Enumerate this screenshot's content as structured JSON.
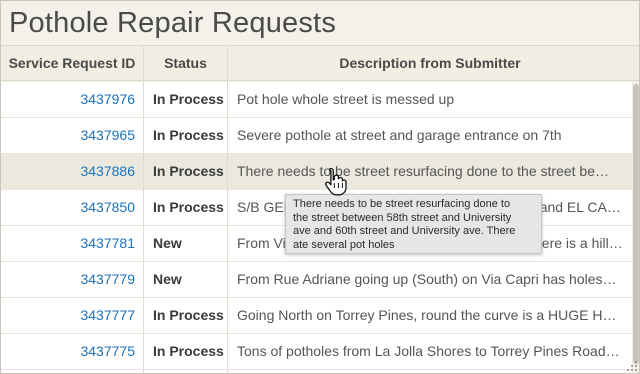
{
  "page": {
    "title": "Pothole Repair Requests"
  },
  "table": {
    "columns": [
      "Service Request ID",
      "Status",
      "Description from Submitter"
    ],
    "rows": [
      {
        "id": "3437976",
        "status": "In Process",
        "description": "Pot hole whole street is messed up"
      },
      {
        "id": "3437965",
        "status": "In Process",
        "description": "Severe pothole at street and garage entrance on 7th"
      },
      {
        "id": "3437886",
        "status": "In Process",
        "description": "There needs to be street resurfacing done to the street be…"
      },
      {
        "id": "3437850",
        "status": "In Process",
        "description": "S/B GENESEE AVE between UNIVERSITY AVE and EL CAJON BL- POTHOL…"
      },
      {
        "id": "3437781",
        "status": "New",
        "description": "From Via Capri going down to La Jolla Shores, there is a hill on Vi…"
      },
      {
        "id": "3437779",
        "status": "New",
        "description": "From Rue Adriane going up (South) on Via Capri has holes…"
      },
      {
        "id": "3437777",
        "status": "In Process",
        "description": "Going North on Torrey Pines, round the curve is a HUGE H…"
      },
      {
        "id": "3437775",
        "status": "In Process",
        "description": "Tons of potholes from La Jolla Shores to Torrey Pines Road…"
      }
    ]
  },
  "tooltip": {
    "lines": [
      "There needs to be street resurfacing done to",
      "the street between 58th street and University",
      "ave and 60th street and University ave. There",
      "ate several pot holes"
    ]
  },
  "hovered_row": 2,
  "colors": {
    "link": "#1e72b8",
    "header_bg": "#f1eee4",
    "hover_bg": "#ebe8de",
    "tooltip_bg": "#e6e6e6"
  },
  "icons": {
    "cursor": "hand-pointer-icon",
    "grip": "resize-grip-icon"
  }
}
